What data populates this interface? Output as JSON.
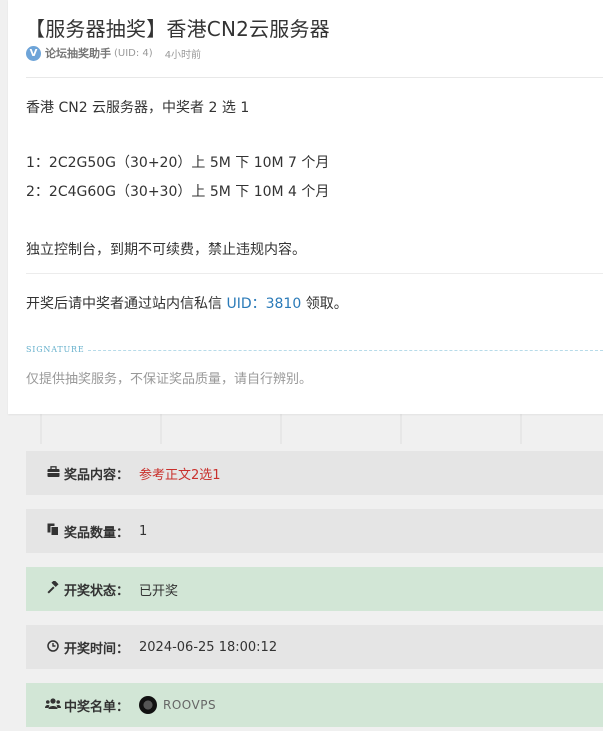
{
  "post": {
    "title": "【服务器抽奖】香港CN2云服务器",
    "author": "论坛抽奖助手",
    "uid": "(UID: 4)",
    "time": "4小时前",
    "lines": [
      "香港 CN2 云服务器，中奖者 2 选 1",
      "1：2C2G50G（30+20）上 5M 下 10M 7 个月",
      "2：2C4G60G（30+30）上 5M 下 10M 4 个月",
      "独立控制台，到期不可续费，禁止违规内容。"
    ],
    "claim_prefix": "开奖后请中奖者通过站内信私信 ",
    "claim_uid": "UID：3810",
    "claim_suffix": " 领取。"
  },
  "signature": {
    "label": "SIGNATURE",
    "text": "仅提供抽奖服务，不保证奖品质量，请自行辨别。"
  },
  "info": {
    "prize_content": {
      "label": "奖品内容：",
      "value": "参考正文2选1",
      "icon": "briefcase-icon"
    },
    "prize_count": {
      "label": "奖品数量：",
      "value": "1",
      "icon": "copy-icon"
    },
    "draw_status": {
      "label": "开奖状态：",
      "value": "已开奖",
      "icon": "gavel-icon"
    },
    "draw_time": {
      "label": "开奖时间：",
      "value": "2024-06-25 18:00:12",
      "icon": "clock-icon"
    },
    "winners": {
      "label": "中奖名单：",
      "value": "ROOVPS",
      "icon": "users-icon"
    }
  },
  "colors": {
    "accent_link": "#2a7ab8",
    "prize_red": "#c9302c",
    "green_box": "#d2e6d6",
    "gray_box": "#e5e5e5"
  }
}
